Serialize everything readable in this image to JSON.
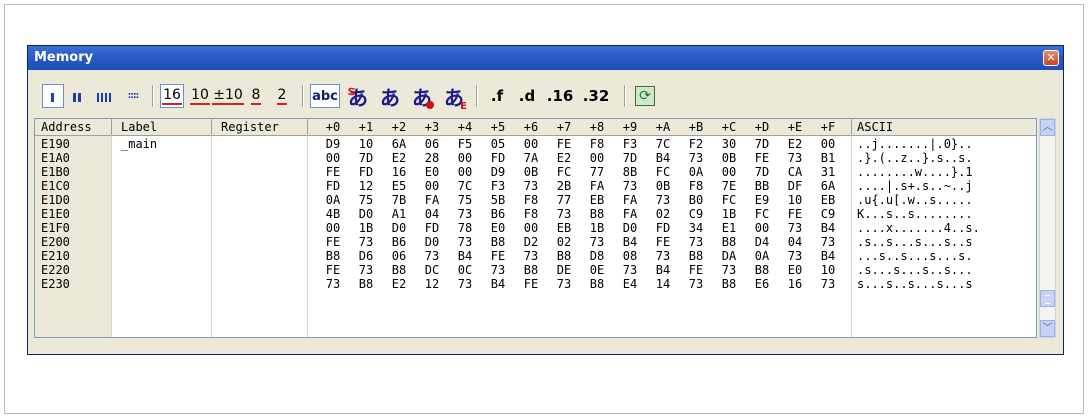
{
  "window": {
    "title": "Memory",
    "close_glyph": "✕"
  },
  "toolbar": {
    "items": [
      {
        "name": "view-1-column-button",
        "type": "bars1",
        "selected": true
      },
      {
        "name": "view-2-column-button",
        "type": "bars2"
      },
      {
        "name": "view-4-column-button",
        "type": "bars4"
      },
      {
        "name": "view-8-column-button",
        "type": "dots8"
      },
      {
        "name": "hex-button",
        "label": "16",
        "selected": true
      },
      {
        "name": "decimal-button",
        "label": "10"
      },
      {
        "name": "signed-decimal-button",
        "label": "±10"
      },
      {
        "name": "octal-button",
        "label": "8"
      },
      {
        "name": "binary-button",
        "label": "2"
      },
      {
        "name": "ascii-button",
        "label": "abc",
        "selected": true
      },
      {
        "name": "sjis-button",
        "label": "あ"
      },
      {
        "name": "jis-button",
        "label": "あ"
      },
      {
        "name": "euc-button",
        "label": "あ"
      },
      {
        "name": "unicode-button",
        "label": "あ"
      },
      {
        "name": "float-button",
        "label": ".f"
      },
      {
        "name": "double-button",
        "label": ".d"
      },
      {
        "name": "fixed16-button",
        "label": ".16"
      },
      {
        "name": "fixed32-button",
        "label": ".32"
      },
      {
        "name": "refresh-button",
        "icon": "refresh-icon"
      }
    ]
  },
  "table": {
    "headers": {
      "address": "Address",
      "label": "Label",
      "register": "Register",
      "offsets": [
        "+0",
        "+1",
        "+2",
        "+3",
        "+4",
        "+5",
        "+6",
        "+7",
        "+8",
        "+9",
        "+A",
        "+B",
        "+C",
        "+D",
        "+E",
        "+F"
      ],
      "ascii": "ASCII"
    },
    "rows": [
      {
        "address": "E190",
        "label": "_main",
        "register": "",
        "bytes": [
          "D9",
          "10",
          "6A",
          "06",
          "F5",
          "05",
          "00",
          "FE",
          "F8",
          "F3",
          "7C",
          "F2",
          "30",
          "7D",
          "E2",
          "00"
        ],
        "ascii": "..j.......|.0}.."
      },
      {
        "address": "E1A0",
        "label": "",
        "register": "",
        "bytes": [
          "00",
          "7D",
          "E2",
          "28",
          "00",
          "FD",
          "7A",
          "E2",
          "00",
          "7D",
          "B4",
          "73",
          "0B",
          "FE",
          "73",
          "B1"
        ],
        "ascii": ".}.(..z..}.s..s."
      },
      {
        "address": "E1B0",
        "label": "",
        "register": "",
        "bytes": [
          "FE",
          "FD",
          "16",
          "E0",
          "00",
          "D9",
          "0B",
          "FC",
          "77",
          "8B",
          "FC",
          "0A",
          "00",
          "7D",
          "CA",
          "31"
        ],
        "ascii": "........w....}.1"
      },
      {
        "address": "E1C0",
        "label": "",
        "register": "",
        "bytes": [
          "FD",
          "12",
          "E5",
          "00",
          "7C",
          "F3",
          "73",
          "2B",
          "FA",
          "73",
          "0B",
          "F8",
          "7E",
          "BB",
          "DF",
          "6A"
        ],
        "ascii": "....|.s+.s..~..j"
      },
      {
        "address": "E1D0",
        "label": "",
        "register": "",
        "bytes": [
          "0A",
          "75",
          "7B",
          "FA",
          "75",
          "5B",
          "F8",
          "77",
          "EB",
          "FA",
          "73",
          "B0",
          "FC",
          "E9",
          "10",
          "EB"
        ],
        "ascii": ".u{.u[.w..s....."
      },
      {
        "address": "E1E0",
        "label": "",
        "register": "",
        "bytes": [
          "4B",
          "D0",
          "A1",
          "04",
          "73",
          "B6",
          "F8",
          "73",
          "B8",
          "FA",
          "02",
          "C9",
          "1B",
          "FC",
          "FE",
          "C9"
        ],
        "ascii": "K...s..s........"
      },
      {
        "address": "E1F0",
        "label": "",
        "register": "",
        "bytes": [
          "00",
          "1B",
          "D0",
          "FD",
          "78",
          "E0",
          "00",
          "EB",
          "1B",
          "D0",
          "FD",
          "34",
          "E1",
          "00",
          "73",
          "B4"
        ],
        "ascii": "....x.......4..s."
      },
      {
        "address": "E200",
        "label": "",
        "register": "",
        "bytes": [
          "FE",
          "73",
          "B6",
          "D0",
          "73",
          "B8",
          "D2",
          "02",
          "73",
          "B4",
          "FE",
          "73",
          "B8",
          "D4",
          "04",
          "73"
        ],
        "ascii": ".s..s...s...s..s"
      },
      {
        "address": "E210",
        "label": "",
        "register": "",
        "bytes": [
          "B8",
          "D6",
          "06",
          "73",
          "B4",
          "FE",
          "73",
          "B8",
          "D8",
          "08",
          "73",
          "B8",
          "DA",
          "0A",
          "73",
          "B4"
        ],
        "ascii": "...s..s...s...s."
      },
      {
        "address": "E220",
        "label": "",
        "register": "",
        "bytes": [
          "FE",
          "73",
          "B8",
          "DC",
          "0C",
          "73",
          "B8",
          "DE",
          "0E",
          "73",
          "B4",
          "FE",
          "73",
          "B8",
          "E0",
          "10"
        ],
        "ascii": ".s...s...s..s..."
      },
      {
        "address": "E230",
        "label": "",
        "register": "",
        "bytes": [
          "73",
          "B8",
          "E2",
          "12",
          "73",
          "B4",
          "FE",
          "73",
          "B8",
          "E4",
          "14",
          "73",
          "B8",
          "E6",
          "16",
          "73"
        ],
        "ascii": "s...s..s...s...s"
      }
    ]
  },
  "scrollbar": {
    "position": 0.92,
    "up_glyph": "︿",
    "down_glyph": "﹀"
  }
}
